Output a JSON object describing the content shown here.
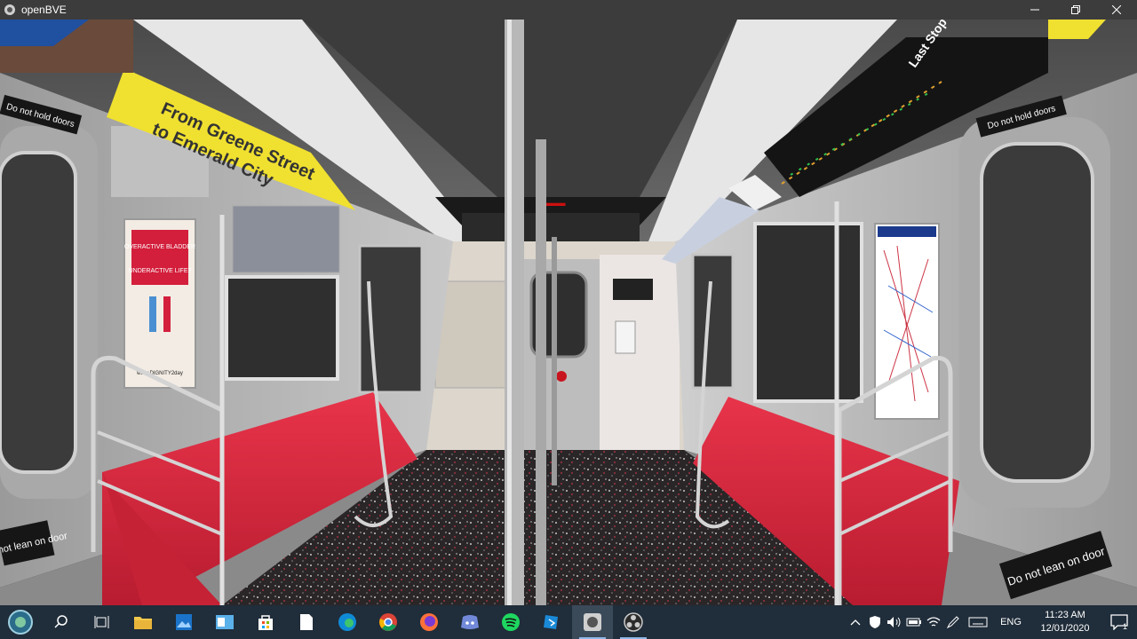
{
  "window": {
    "title": "openBVE"
  },
  "window_buttons": {
    "minimize_icon": "minimize-icon",
    "maximize_icon": "maximize-icon",
    "close_icon": "close-icon"
  },
  "scene": {
    "banner_left_line1": "From Greene Street",
    "banner_left_line2": "to Emerald City",
    "banner_right": "Last Stop",
    "ad_left_line1": "OVERACTIVE BLADDER",
    "ad_left_line2": "UNDERACTIVE LIFE?",
    "ad_left_url": "www.DIGNITY2day",
    "door_sign_left": "Do not lean on door",
    "door_sign_right": "Do not lean on door",
    "door_top_right": "Do not hold doors",
    "door_top_left": "Do not hold doors"
  },
  "taskbar": {
    "apps": [
      "start",
      "search",
      "task-view",
      "file-explorer",
      "photos",
      "outlook",
      "store",
      "notepad",
      "edge",
      "chrome",
      "firefox",
      "discord",
      "spotify",
      "maps",
      "openbve",
      "obs"
    ]
  },
  "tray": {
    "language": "ENG",
    "time": "11:23 AM",
    "date": "12/01/2020",
    "notification_count": "1"
  },
  "colors": {
    "seat_red": "#d8283c",
    "banner_yellow": "#f0e030",
    "taskbar_bg": "#202d3a"
  }
}
